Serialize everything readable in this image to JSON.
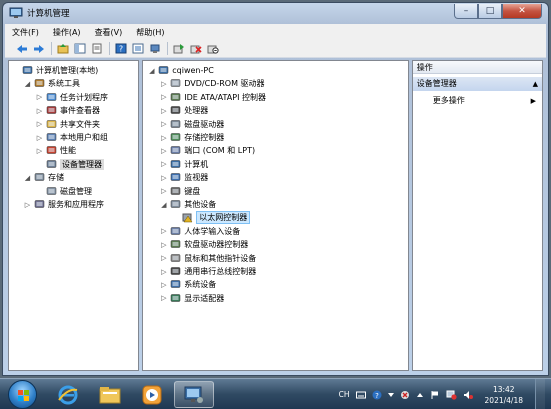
{
  "window": {
    "title": "计算机管理",
    "minimize_glyph": "–",
    "maximize_glyph": "□",
    "close_glyph": "✕"
  },
  "menu": [
    "文件(F)",
    "操作(A)",
    "查看(V)",
    "帮助(H)"
  ],
  "toolbar_icons": [
    "back-arrow-icon",
    "forward-arrow-icon",
    "up-folder-icon",
    "show-hide-tree-icon",
    "properties-icon",
    "help-icon",
    "help-topic-icon",
    "console-tree-icon",
    "update-driver-icon",
    "uninstall-icon",
    "disable-device-icon"
  ],
  "left_tree": [
    {
      "label": "计算机管理(本地)",
      "level": 0,
      "expander": "",
      "icon": "computer-management-icon"
    },
    {
      "label": "系统工具",
      "level": 1,
      "expander": "◢",
      "icon": "tools-icon"
    },
    {
      "label": "任务计划程序",
      "level": 2,
      "expander": "▷",
      "icon": "clock-icon"
    },
    {
      "label": "事件查看器",
      "level": 2,
      "expander": "▷",
      "icon": "event-viewer-icon"
    },
    {
      "label": "共享文件夹",
      "level": 2,
      "expander": "▷",
      "icon": "shared-folder-icon"
    },
    {
      "label": "本地用户和组",
      "level": 2,
      "expander": "▷",
      "icon": "users-icon"
    },
    {
      "label": "性能",
      "level": 2,
      "expander": "▷",
      "icon": "performance-icon"
    },
    {
      "label": "设备管理器",
      "level": 2,
      "expander": "",
      "icon": "device-manager-icon",
      "selected": true
    },
    {
      "label": "存储",
      "level": 1,
      "expander": "◢",
      "icon": "storage-icon"
    },
    {
      "label": "磁盘管理",
      "level": 2,
      "expander": "",
      "icon": "disk-management-icon"
    },
    {
      "label": "服务和应用程序",
      "level": 1,
      "expander": "▷",
      "icon": "services-icon"
    }
  ],
  "device_tree": [
    {
      "label": "cqiwen-PC",
      "level": 0,
      "expander": "◢",
      "icon": "computer-icon"
    },
    {
      "label": "DVD/CD-ROM 驱动器",
      "level": 1,
      "expander": "▷",
      "icon": "dvd-drive-icon"
    },
    {
      "label": "IDE ATA/ATAPI 控制器",
      "level": 1,
      "expander": "▷",
      "icon": "ide-controller-icon"
    },
    {
      "label": "处理器",
      "level": 1,
      "expander": "▷",
      "icon": "processor-icon"
    },
    {
      "label": "磁盘驱动器",
      "level": 1,
      "expander": "▷",
      "icon": "disk-drive-icon"
    },
    {
      "label": "存储控制器",
      "level": 1,
      "expander": "▷",
      "icon": "storage-controller-icon"
    },
    {
      "label": "端口 (COM 和 LPT)",
      "level": 1,
      "expander": "▷",
      "icon": "port-icon"
    },
    {
      "label": "计算机",
      "level": 1,
      "expander": "▷",
      "icon": "computer-icon"
    },
    {
      "label": "监视器",
      "level": 1,
      "expander": "▷",
      "icon": "monitor-icon"
    },
    {
      "label": "键盘",
      "level": 1,
      "expander": "▷",
      "icon": "keyboard-icon"
    },
    {
      "label": "其他设备",
      "level": 1,
      "expander": "◢",
      "icon": "other-devices-icon"
    },
    {
      "label": "以太网控制器",
      "level": 2,
      "expander": "",
      "icon": "warning-device-icon",
      "selected": true
    },
    {
      "label": "人体学输入设备",
      "level": 1,
      "expander": "▷",
      "icon": "hid-icon"
    },
    {
      "label": "软盘驱动器控制器",
      "level": 1,
      "expander": "▷",
      "icon": "floppy-controller-icon"
    },
    {
      "label": "鼠标和其他指针设备",
      "level": 1,
      "expander": "▷",
      "icon": "mouse-icon"
    },
    {
      "label": "通用串行总线控制器",
      "level": 1,
      "expander": "▷",
      "icon": "usb-icon"
    },
    {
      "label": "系统设备",
      "level": 1,
      "expander": "▷",
      "icon": "system-devices-icon"
    },
    {
      "label": "显示适配器",
      "level": 1,
      "expander": "▷",
      "icon": "display-adapter-icon"
    }
  ],
  "actions": {
    "header": "操作",
    "group": "设备管理器",
    "group_arrow": "▲",
    "more": "更多操作",
    "more_arrow": "▶"
  },
  "taskbar": {
    "apps": [
      "internet-explorer-icon",
      "file-explorer-icon",
      "media-player-icon",
      "computer-management-icon"
    ],
    "tray": {
      "language": "CH",
      "time": "13:42",
      "date": "2021/4/18"
    }
  },
  "colors": {
    "selection_blue": "#cce8ff",
    "selection_grey": "#dbdbdb",
    "actions_group": "#c4d5ee"
  }
}
